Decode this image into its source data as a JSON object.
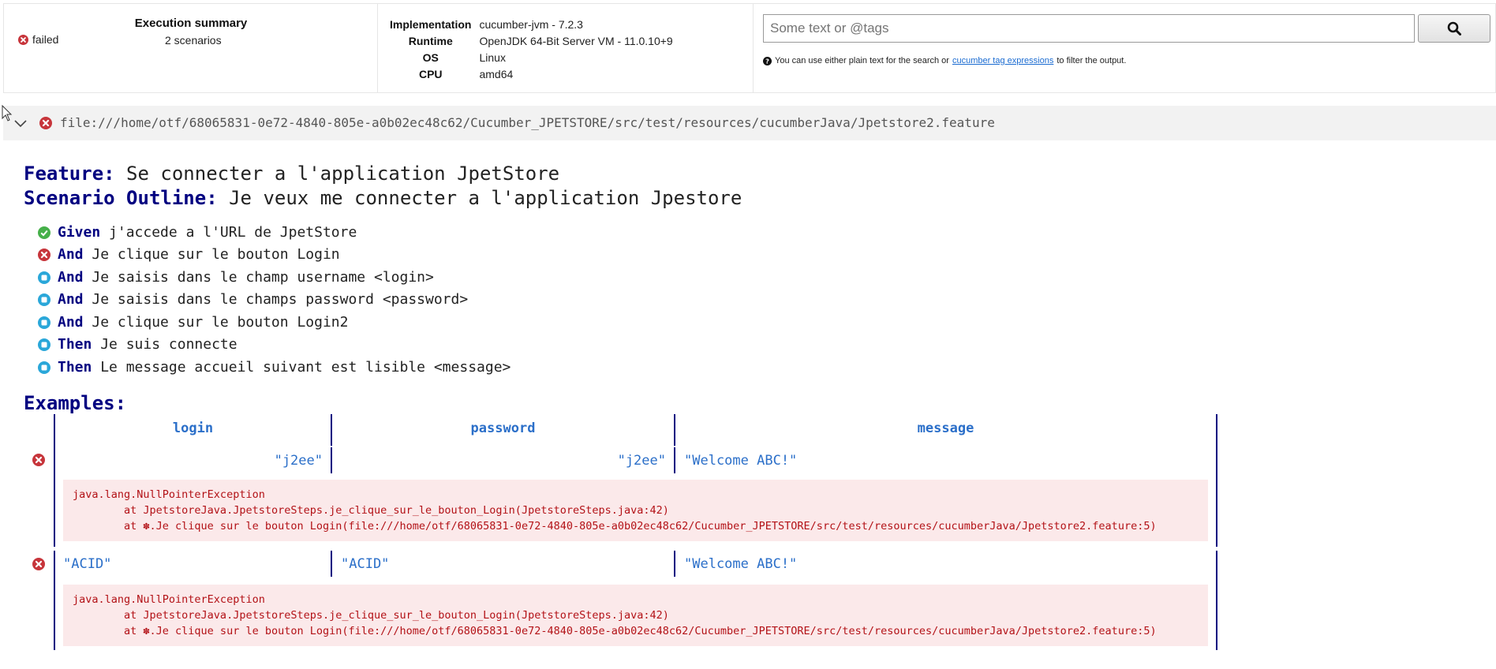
{
  "summary": {
    "title": "Execution summary",
    "status": "failed",
    "scenarios": "2 scenarios"
  },
  "environment": [
    {
      "key": "Implementation",
      "value": "cucumber-jvm - 7.2.3"
    },
    {
      "key": "Runtime",
      "value": "OpenJDK 64-Bit Server VM - 11.0.10+9"
    },
    {
      "key": "OS",
      "value": "Linux"
    },
    {
      "key": "CPU",
      "value": "amd64"
    }
  ],
  "search": {
    "placeholder": "Some text or @tags",
    "help_prefix": "You can use either plain text for the search or",
    "help_link": "cucumber tag expressions",
    "help_suffix": "to filter the output."
  },
  "feature_file": {
    "path": "file:///home/otf/68065831-0e72-4840-805e-a0b02ec48c62/Cucumber_JPETSTORE/src/test/resources/cucumberJava/Jpetstore2.feature"
  },
  "feature": {
    "keyword": "Feature:",
    "name": "Se connecter a l'application JpetStore"
  },
  "scenario_outline": {
    "keyword": "Scenario Outline:",
    "name": "Je veux me connecter a l'application Jpestore"
  },
  "steps": [
    {
      "keyword": "Given",
      "text": "j'accede a l'URL de JpetStore",
      "status": "passed"
    },
    {
      "keyword": "And",
      "text": "Je clique sur le bouton Login",
      "status": "failed"
    },
    {
      "keyword": "And",
      "text": "Je saisis dans le champ username <login>",
      "status": "skipped"
    },
    {
      "keyword": "And",
      "text": "Je saisis dans le champs password <password>",
      "status": "skipped"
    },
    {
      "keyword": "And",
      "text": "Je clique sur le bouton Login2",
      "status": "skipped"
    },
    {
      "keyword": "Then",
      "text": "Je suis connecte",
      "status": "skipped"
    },
    {
      "keyword": "Then",
      "text": "Le message accueil suivant est lisible <message>",
      "status": "skipped"
    }
  ],
  "examples": {
    "title": "Examples:",
    "headers": [
      "login",
      "password",
      "message"
    ],
    "rows": [
      {
        "status": "failed",
        "cells": [
          "\"j2ee\"",
          "\"j2ee\"",
          "\"Welcome ABC!\""
        ],
        "error": [
          "java.lang.NullPointerException",
          "        at JpetstoreJava.JpetstoreSteps.je_clique_sur_le_bouton_Login(JpetstoreSteps.java:42)",
          "        at ✽.Je clique sur le bouton Login(file:///home/otf/68065831-0e72-4840-805e-a0b02ec48c62/Cucumber_JPETSTORE/src/test/resources/cucumberJava/Jpetstore2.feature:5)"
        ]
      },
      {
        "status": "failed",
        "cells": [
          "\"ACID\"",
          "\"ACID\"",
          "\"Welcome ABC!\""
        ],
        "error": [
          "java.lang.NullPointerException",
          "        at JpetstoreJava.JpetstoreSteps.je_clique_sur_le_bouton_Login(JpetstoreSteps.java:42)",
          "        at ✽.Je clique sur le bouton Login(file:///home/otf/68065831-0e72-4840-805e-a0b02ec48c62/Cucumber_JPETSTORE/src/test/resources/cucumberJava/Jpetstore2.feature:5)"
        ]
      }
    ]
  },
  "colors": {
    "passed": "#46b04a",
    "failed": "#c7353b",
    "skipped": "#2aa7d9",
    "keyword": "#000080",
    "link": "#1a6bd1",
    "error_bg": "#fbe9ea",
    "error_text": "#b31217"
  },
  "icons": {
    "failed": "x-circle-icon",
    "passed": "check-circle-icon",
    "skipped": "stop-circle-icon",
    "search": "search-icon",
    "expand": "chevron-down-icon",
    "help": "question-circle-icon"
  }
}
